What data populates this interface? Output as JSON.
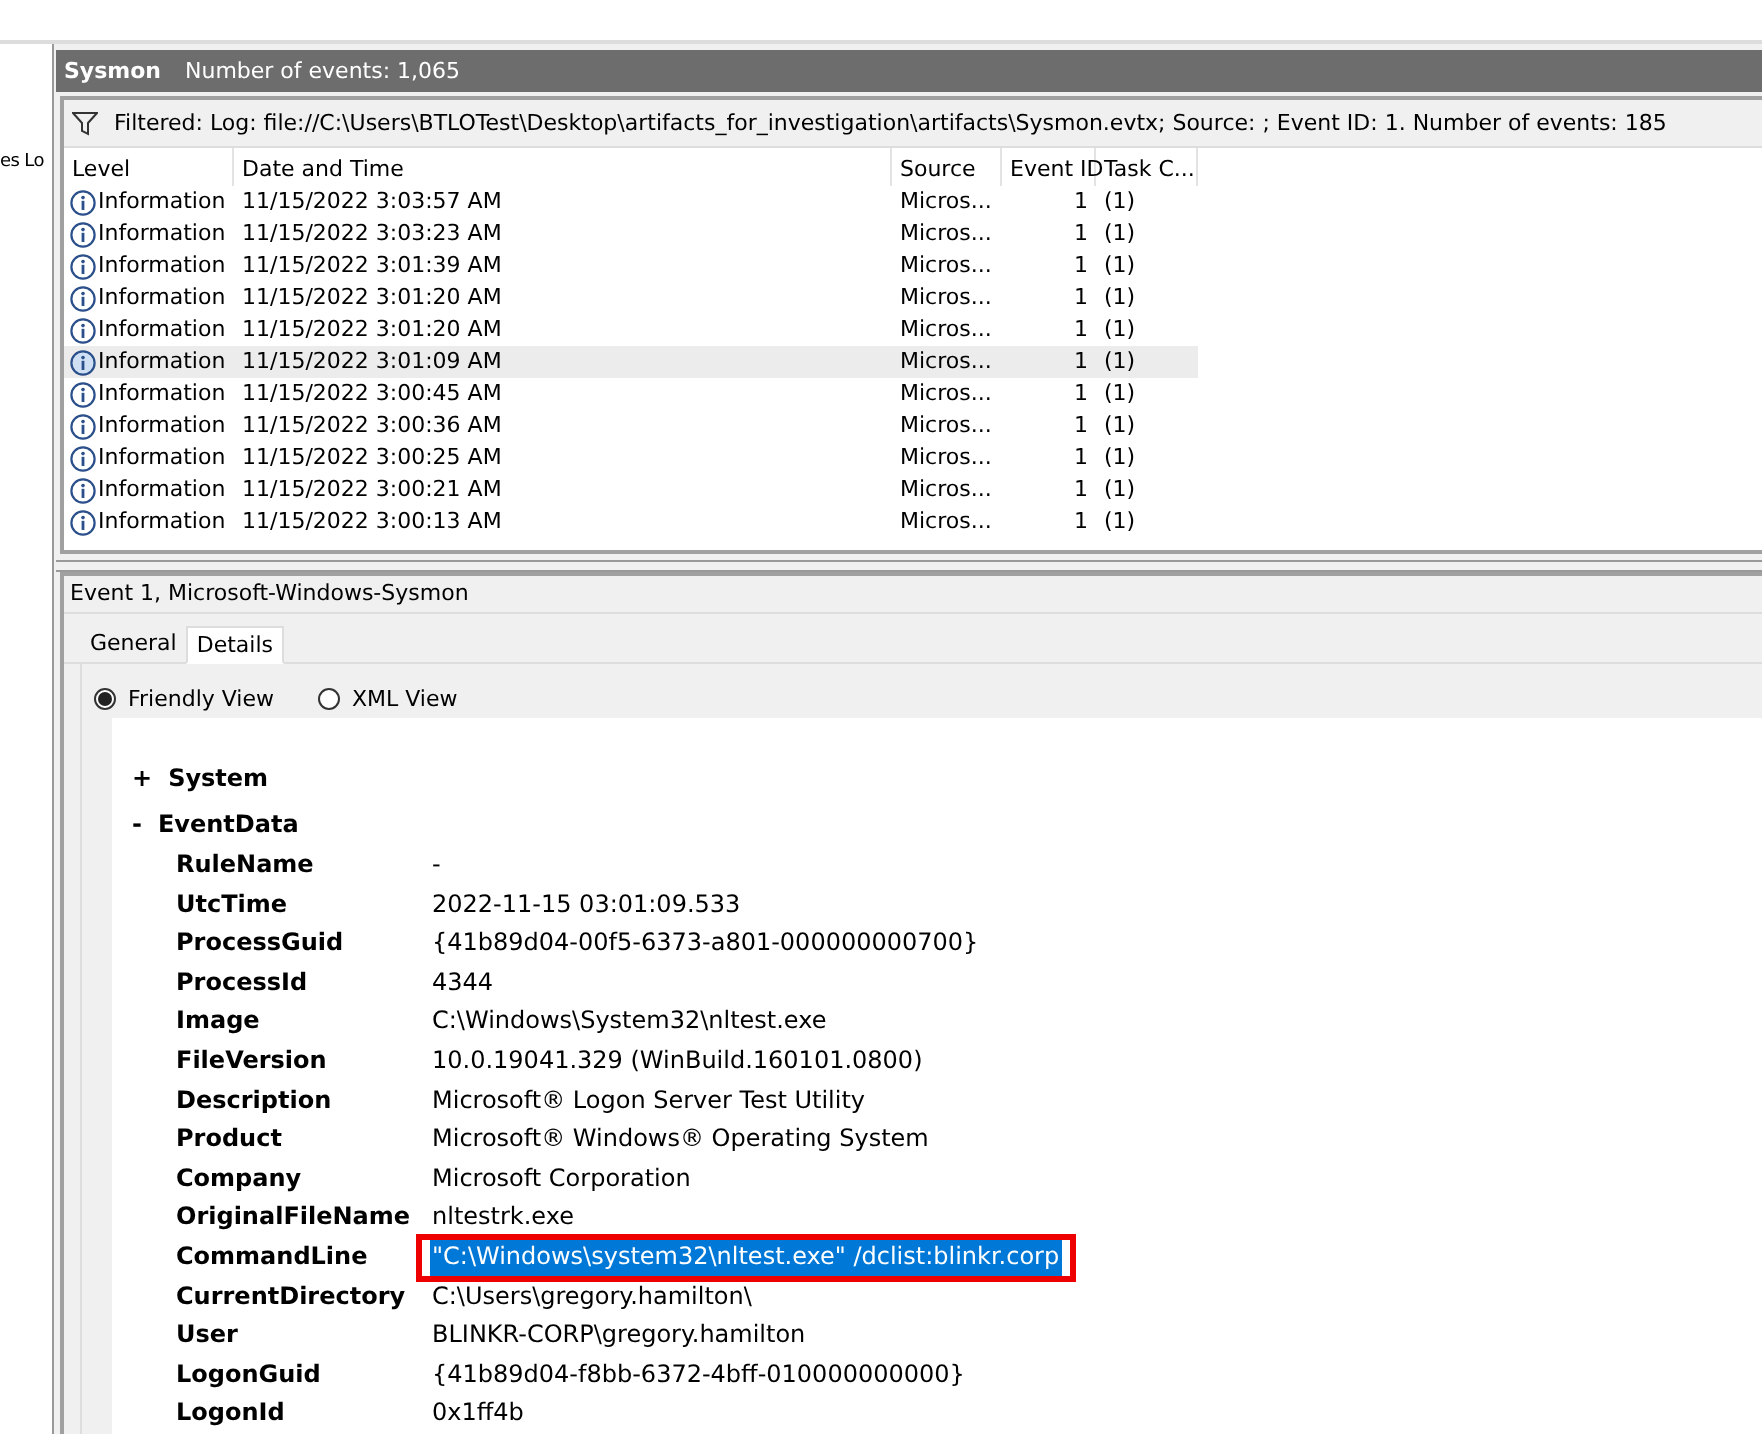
{
  "sidebar": {
    "label": "es Lo"
  },
  "log_header": {
    "name": "Sysmon",
    "count": "Number of events: 1,065"
  },
  "filter_bar": {
    "text": "Filtered: Log: file://C:\\Users\\BTLOTest\\Desktop\\artifacts_for_investigation\\artifacts\\Sysmon.evtx; Source: ; Event ID: 1. Number of events: 185"
  },
  "table": {
    "columns": [
      "Level",
      "Date and Time",
      "Source",
      "Event ID",
      "Task C..."
    ],
    "rows": [
      {
        "level": "Information",
        "date": "11/15/2022 3:03:57 AM",
        "source": "Micros...",
        "event_id": "1",
        "task": "(1)",
        "selected": false
      },
      {
        "level": "Information",
        "date": "11/15/2022 3:03:23 AM",
        "source": "Micros...",
        "event_id": "1",
        "task": "(1)",
        "selected": false
      },
      {
        "level": "Information",
        "date": "11/15/2022 3:01:39 AM",
        "source": "Micros...",
        "event_id": "1",
        "task": "(1)",
        "selected": false
      },
      {
        "level": "Information",
        "date": "11/15/2022 3:01:20 AM",
        "source": "Micros...",
        "event_id": "1",
        "task": "(1)",
        "selected": false
      },
      {
        "level": "Information",
        "date": "11/15/2022 3:01:20 AM",
        "source": "Micros...",
        "event_id": "1",
        "task": "(1)",
        "selected": false
      },
      {
        "level": "Information",
        "date": "11/15/2022 3:01:09 AM",
        "source": "Micros...",
        "event_id": "1",
        "task": "(1)",
        "selected": true
      },
      {
        "level": "Information",
        "date": "11/15/2022 3:00:45 AM",
        "source": "Micros...",
        "event_id": "1",
        "task": "(1)",
        "selected": false
      },
      {
        "level": "Information",
        "date": "11/15/2022 3:00:36 AM",
        "source": "Micros...",
        "event_id": "1",
        "task": "(1)",
        "selected": false
      },
      {
        "level": "Information",
        "date": "11/15/2022 3:00:25 AM",
        "source": "Micros...",
        "event_id": "1",
        "task": "(1)",
        "selected": false
      },
      {
        "level": "Information",
        "date": "11/15/2022 3:00:21 AM",
        "source": "Micros...",
        "event_id": "1",
        "task": "(1)",
        "selected": false
      },
      {
        "level": "Information",
        "date": "11/15/2022 3:00:13 AM",
        "source": "Micros...",
        "event_id": "1",
        "task": "(1)",
        "selected": false
      }
    ]
  },
  "event_pane": {
    "title": "Event 1, Microsoft-Windows-Sysmon",
    "tabs": [
      {
        "label": "General",
        "selected": false
      },
      {
        "label": "Details",
        "selected": true
      }
    ],
    "views": [
      {
        "label": "Friendly View",
        "selected": true
      },
      {
        "label": "XML View",
        "selected": false
      }
    ],
    "sections": [
      {
        "toggle": "+",
        "name": "System"
      },
      {
        "toggle": "-",
        "name": "EventData",
        "fields": [
          {
            "name": "RuleName",
            "value": "-",
            "selected": false
          },
          {
            "name": "UtcTime",
            "value": "2022-11-15 03:01:09.533",
            "selected": false
          },
          {
            "name": "ProcessGuid",
            "value": "{41b89d04-00f5-6373-a801-000000000700}",
            "selected": false
          },
          {
            "name": "ProcessId",
            "value": "4344",
            "selected": false
          },
          {
            "name": "Image",
            "value": "C:\\Windows\\System32\\nltest.exe",
            "selected": false
          },
          {
            "name": "FileVersion",
            "value": "10.0.19041.329 (WinBuild.160101.0800)",
            "selected": false
          },
          {
            "name": "Description",
            "value": "Microsoft® Logon Server Test Utility",
            "selected": false
          },
          {
            "name": "Product",
            "value": "Microsoft® Windows® Operating System",
            "selected": false
          },
          {
            "name": "Company",
            "value": "Microsoft Corporation",
            "selected": false
          },
          {
            "name": "OriginalFileName",
            "value": "nltestrk.exe",
            "selected": false
          },
          {
            "name": "CommandLine",
            "value": "\"C:\\Windows\\system32\\nltest.exe\" /dclist:blinkr.corp",
            "selected": true
          },
          {
            "name": "CurrentDirectory",
            "value": "C:\\Users\\gregory.hamilton\\",
            "selected": false
          },
          {
            "name": "User",
            "value": "BLINKR-CORP\\gregory.hamilton",
            "selected": false
          },
          {
            "name": "LogonGuid",
            "value": "{41b89d04-f8bb-6372-4bff-010000000000}",
            "selected": false
          },
          {
            "name": "LogonId",
            "value": "0x1ff4b",
            "selected": false
          }
        ]
      }
    ]
  }
}
